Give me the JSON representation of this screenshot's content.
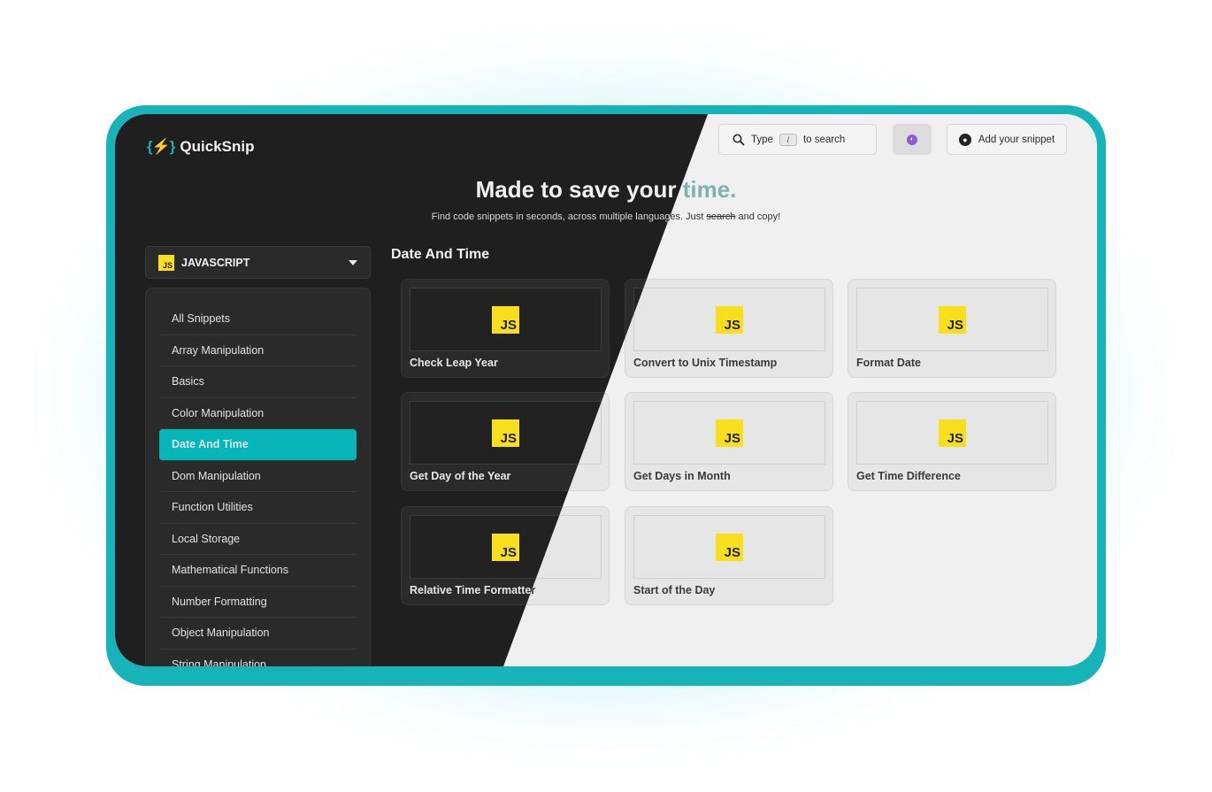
{
  "app": {
    "logo_glyph": "{⚡}",
    "name": "QuickSnip"
  },
  "header": {
    "search": {
      "prefix": "Type",
      "key": "/",
      "suffix": "to search"
    },
    "bubble_glyph": "◐",
    "github_label": "Add your snippet"
  },
  "hero": {
    "title_main": "Made to save your ",
    "title_accent": "time.",
    "subtitle_before": "Find code snippets in seconds, across multiple languages. Just ",
    "subtitle_struck": "search",
    "subtitle_after": " and copy!"
  },
  "language": {
    "badge": "JS",
    "label": "JAVASCRIPT"
  },
  "sidebar": {
    "items": [
      {
        "label": "All Snippets"
      },
      {
        "label": "Array Manipulation"
      },
      {
        "label": "Basics"
      },
      {
        "label": "Color Manipulation"
      },
      {
        "label": "Date And Time",
        "active": true
      },
      {
        "label": "Dom Manipulation"
      },
      {
        "label": "Function Utilities"
      },
      {
        "label": "Local Storage"
      },
      {
        "label": "Mathematical Functions"
      },
      {
        "label": "Number Formatting"
      },
      {
        "label": "Object Manipulation"
      },
      {
        "label": "String Manipulation"
      }
    ]
  },
  "main": {
    "section_title": "Date And Time",
    "cards": [
      {
        "badge": "JS",
        "title": "Check Leap Year"
      },
      {
        "badge": "JS",
        "title": "Convert to Unix Timestamp"
      },
      {
        "badge": "JS",
        "title": "Format Date"
      },
      {
        "badge": "JS",
        "title": "Get Day of the Year"
      },
      {
        "badge": "JS",
        "title": "Get Days in Month"
      },
      {
        "badge": "JS",
        "title": "Get Time Difference"
      },
      {
        "badge": "JS",
        "title": "Relative Time Formatter"
      },
      {
        "badge": "JS",
        "title": "Start of the Day"
      }
    ]
  },
  "colors": {
    "accent": "#05b5b8",
    "frame": "#16b4b8",
    "js_yellow": "#f7df1e",
    "dark_bg": "#1f1f1f",
    "light_bg": "#f0f0f0"
  }
}
